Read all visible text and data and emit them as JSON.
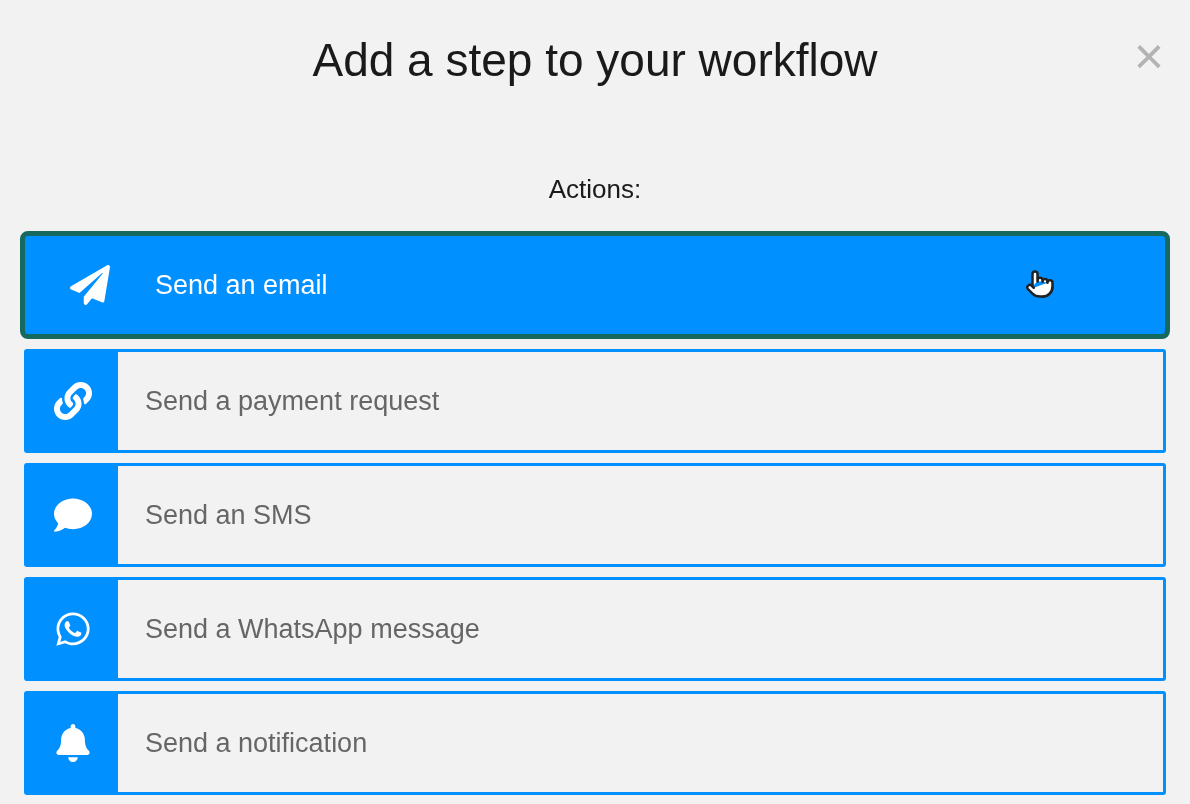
{
  "dialog": {
    "title": "Add a step to your workflow",
    "close": "×"
  },
  "section_label": "Actions:",
  "actions": [
    {
      "label": "Send an email",
      "selected": true
    },
    {
      "label": "Send a payment request",
      "selected": false
    },
    {
      "label": "Send an SMS",
      "selected": false
    },
    {
      "label": "Send a WhatsApp message",
      "selected": false
    },
    {
      "label": "Send a notification",
      "selected": false
    }
  ]
}
